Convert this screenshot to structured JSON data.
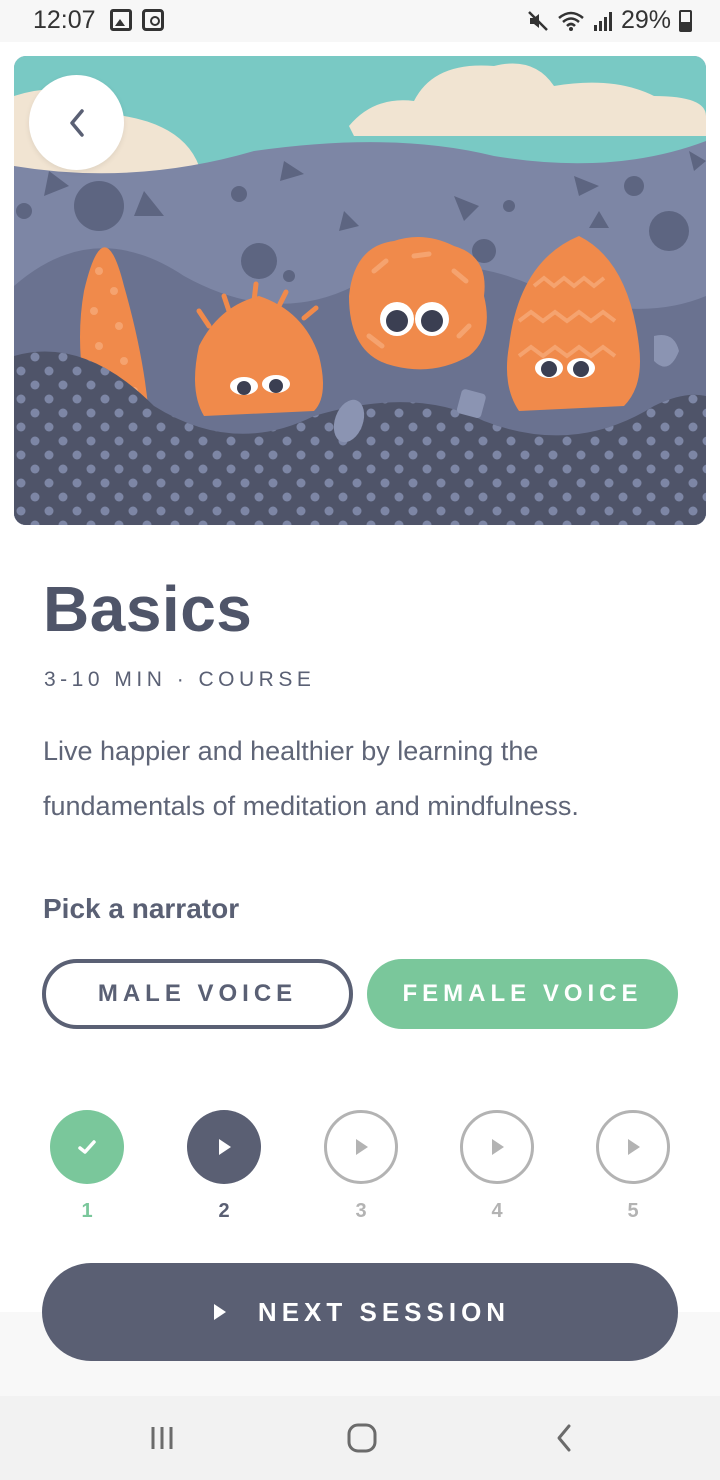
{
  "status_bar": {
    "time": "12:07",
    "battery": "29%",
    "icons": [
      "image-icon",
      "clock-icon",
      "mute-icon",
      "wifi-icon",
      "signal-icon",
      "battery-icon"
    ]
  },
  "hero": {
    "icons": [
      "back-arrow-icon"
    ]
  },
  "course": {
    "title": "Basics",
    "meta": "3-10 MIN · COURSE",
    "description": "Live happier and healthier by learning the fundamentals of meditation and mindfulness."
  },
  "narrator": {
    "label": "Pick a narrator",
    "male": "MALE VOICE",
    "female": "FEMALE VOICE",
    "selected": "FEMALE VOICE"
  },
  "sessions": [
    {
      "number": "1",
      "state": "completed"
    },
    {
      "number": "2",
      "state": "current"
    },
    {
      "number": "3",
      "state": "locked"
    },
    {
      "number": "4",
      "state": "locked"
    },
    {
      "number": "5",
      "state": "locked"
    }
  ],
  "cta": {
    "label": "NEXT SESSION"
  },
  "colors": {
    "accent_green": "#7ac79b",
    "dark_slate": "#5a5f73",
    "text": "#5a6074",
    "muted": "#b3b3b3"
  },
  "nav": {
    "icons": [
      "recents-icon",
      "home-icon",
      "back-icon"
    ]
  }
}
